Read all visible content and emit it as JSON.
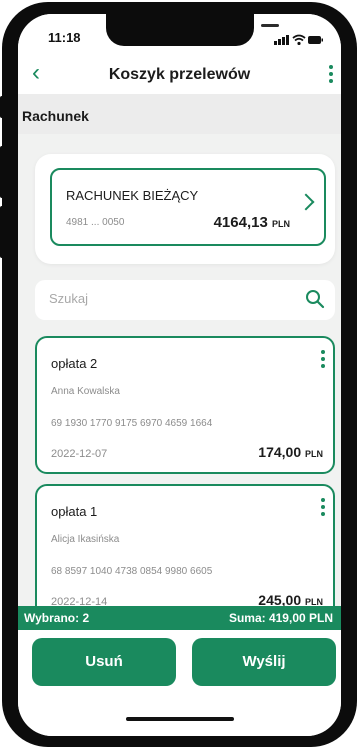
{
  "status_bar": {
    "time": "11:18"
  },
  "header": {
    "title": "Koszyk przelewów"
  },
  "section": {
    "label": "Rachunek"
  },
  "account": {
    "name": "RACHUNEK BIEŻĄCY",
    "number": "4981 ... 0050",
    "balance_main": "4164,13",
    "currency": "PLN"
  },
  "search": {
    "placeholder": "Szukaj"
  },
  "transfers": [
    {
      "name": "opłata 2",
      "recipient": "Anna Kowalska",
      "account": "69 1930 1770 9175 6970 4659 1664",
      "date": "2022-12-07",
      "amount": "174,00",
      "currency": "PLN"
    },
    {
      "name": "opłata 1",
      "recipient": "Alicja Ikasińska",
      "account": "68 8597 1040 4738 0854 9980 6605",
      "date": "2022-12-14",
      "amount": "245,00",
      "currency": "PLN"
    }
  ],
  "summary": {
    "selected": "Wybrano: 2",
    "total": "Suma: 419,00 PLN"
  },
  "buttons": {
    "delete": "Usuń",
    "send": "Wyślij"
  },
  "colors": {
    "accent": "#1a8a5e",
    "background": "#f1f2f1"
  }
}
